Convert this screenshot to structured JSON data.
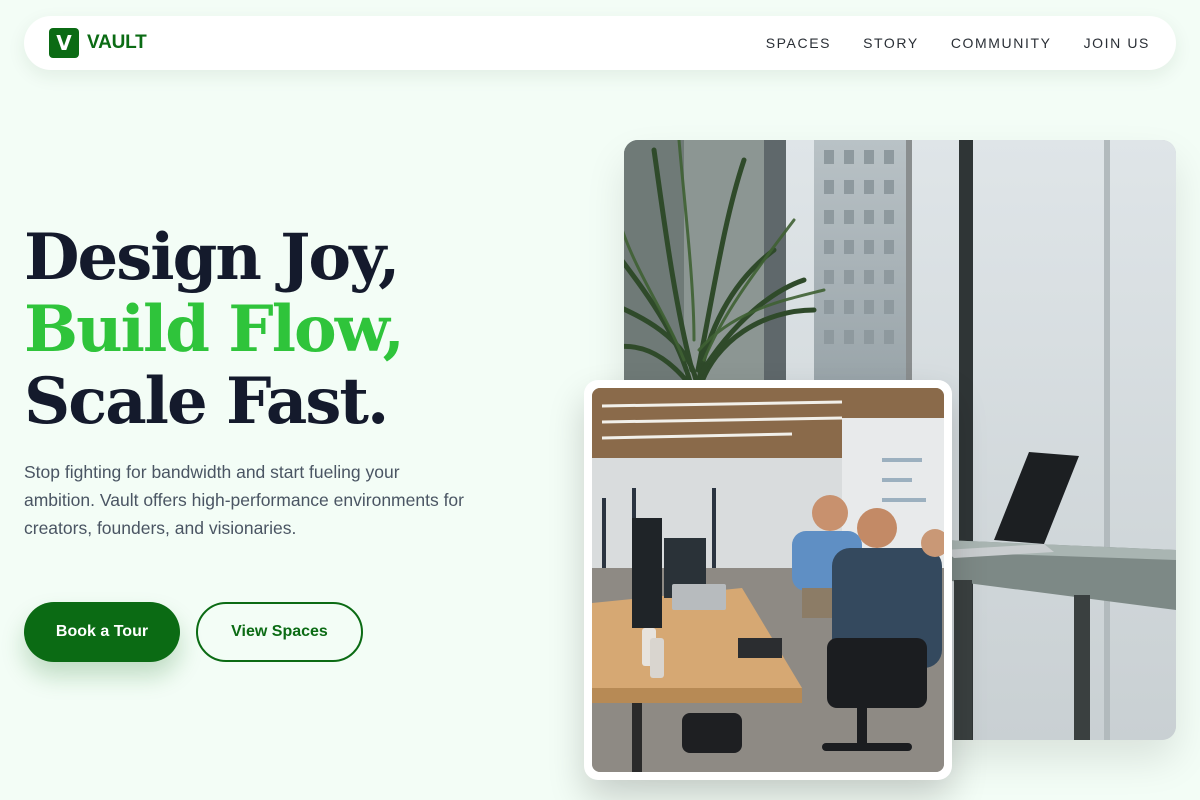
{
  "brand": {
    "mark": "V",
    "name": "VAULT"
  },
  "nav": {
    "links": [
      "SPACES",
      "STORY",
      "COMMUNITY",
      "JOIN US"
    ]
  },
  "hero": {
    "title_line1": "Design Joy,",
    "title_line2": "Build Flow,",
    "title_line3": "Scale Fast.",
    "description": "Stop fighting for bandwidth and start fueling your ambition. Vault offers high-performance environments for creators, founders, and visionaries.",
    "primary_cta": "Book a Tour",
    "secondary_cta": "View Spaces"
  },
  "images": {
    "main": {
      "icon": "office-window-photo-icon"
    },
    "inset": {
      "icon": "coworking-desks-photo-icon"
    }
  },
  "colors": {
    "background": "#f3fdf6",
    "brand_green": "#0b6b14",
    "accent_green": "#2fc43b",
    "heading": "#141a2c",
    "body_text": "#4a5563"
  }
}
